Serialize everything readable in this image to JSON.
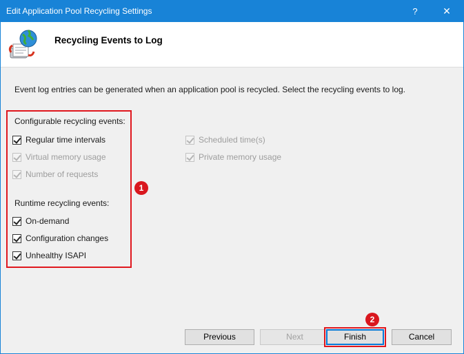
{
  "window": {
    "title": "Edit Application Pool Recycling Settings",
    "help_glyph": "?",
    "close_glyph": "✕"
  },
  "header": {
    "title": "Recycling Events to Log"
  },
  "description": "Event log entries can be generated when an application pool is recycled. Select the recycling events to log.",
  "configurable": {
    "label": "Configurable recycling events:",
    "items": [
      {
        "label": "Regular time intervals",
        "checked": true,
        "enabled": true
      },
      {
        "label": "Virtual memory usage",
        "checked": true,
        "enabled": false
      },
      {
        "label": "Number of requests",
        "checked": true,
        "enabled": false
      },
      {
        "label": "Scheduled time(s)",
        "checked": true,
        "enabled": false
      },
      {
        "label": "Private memory usage",
        "checked": true,
        "enabled": false
      }
    ]
  },
  "runtime": {
    "label": "Runtime recycling events:",
    "items": [
      {
        "label": "On-demand",
        "checked": true,
        "enabled": true
      },
      {
        "label": "Configuration changes",
        "checked": true,
        "enabled": true
      },
      {
        "label": "Unhealthy ISAPI",
        "checked": true,
        "enabled": true
      }
    ]
  },
  "annotations": {
    "badge1": "1",
    "badge2": "2",
    "accent": "#e0161d"
  },
  "buttons": {
    "previous": "Previous",
    "next": "Next",
    "finish": "Finish",
    "cancel": "Cancel"
  },
  "colors": {
    "titlebar": "#1883d7",
    "default_button_border": "#0078d7"
  }
}
